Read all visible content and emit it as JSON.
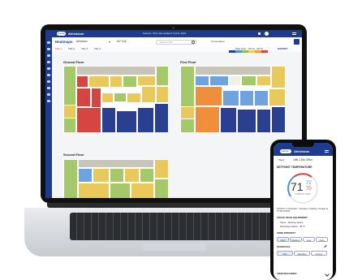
{
  "app": {
    "brand": "Carrier",
    "product": "Ahhvision",
    "notice": "Feature: Test Last updated: Feb 8, 2022",
    "page_title": "Heatmaps",
    "view_select": "Ahhvision",
    "metric_select": "AH TGA",
    "search_placeholder": "Search floor",
    "temperature_toggle": "Temperature",
    "status_text": "Past Hour · 15:14 - 16:14",
    "export_label": "EXPORT",
    "filters": [
      "Title 1",
      "Title 2",
      "Title 3",
      "Title 4"
    ],
    "legend_colors": [
      "#2a3f8f",
      "#4f8fd9",
      "#8bc34a",
      "#f2c94c",
      "#f2994a",
      "#d64541"
    ]
  },
  "floors": {
    "ground": "Ground Floor",
    "first": "First Floor",
    "second": "Second Floor"
  },
  "phone": {
    "brand": "Carrier",
    "product": "Ahhvision",
    "back_label": "< Back",
    "room_title": "LBB-1 Elly Office",
    "section_title": "SETPOINT TEMPERATURE",
    "current_temp": "71",
    "setpoint_high": "72",
    "setpoint_low": "70",
    "temp_caption": "CURRENT TEMP",
    "status_line": "STATUS: In Schedule · Changes in Setting: Average at 07 PM & 8AM",
    "equipment_title": "SPACE PEAK EQUIPMENT",
    "equipment_name": "Name · Meeting Space",
    "equipment_setting": "Discharge Airflow · 38 °F",
    "fan_title": "ZONE PRIORITY",
    "fan_options": [
      "High",
      "Medium",
      "Low",
      "Auto"
    ],
    "schedule_title": "SCHEDULE",
    "schedule_options": [
      "Occ",
      "Standby",
      "Unocc"
    ],
    "bottom_label": "VIEW MACHINES"
  }
}
